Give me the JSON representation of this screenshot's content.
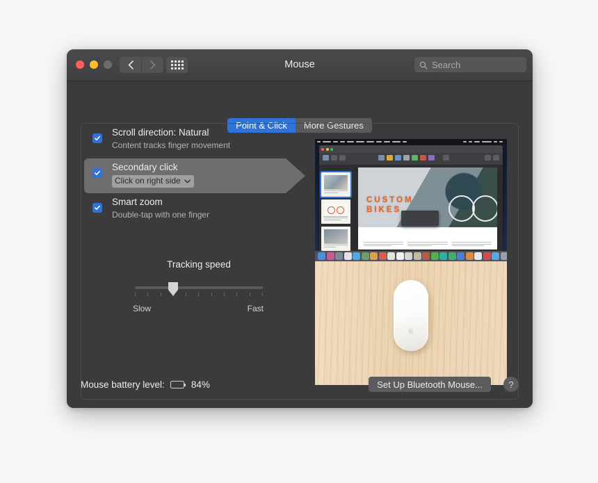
{
  "window": {
    "title": "Mouse",
    "traffic_lights": [
      "close",
      "minimize",
      "zoom-disabled"
    ],
    "nav": {
      "back_icon": "chevron-left-icon",
      "forward_icon": "chevron-right-icon"
    },
    "grid_button_icon": "grid-dots-icon",
    "search": {
      "placeholder": "Search",
      "value": "",
      "icon": "search-icon"
    }
  },
  "tabs": [
    {
      "label": "Point & Click",
      "active": true
    },
    {
      "label": "More Gestures",
      "active": false
    }
  ],
  "options": [
    {
      "title": "Scroll direction: Natural",
      "subtitle": "Content tracks finger movement",
      "checked": true,
      "highlighted": false
    },
    {
      "title": "Secondary click",
      "subtitle": "",
      "checked": true,
      "highlighted": true,
      "popup": {
        "value": "Click on right side",
        "chevron_icon": "chevron-down-icon"
      }
    },
    {
      "title": "Smart zoom",
      "subtitle": "Double-tap with one finger",
      "checked": true,
      "highlighted": false
    }
  ],
  "tracking": {
    "label": "Tracking speed",
    "slow_label": "Slow",
    "fast_label": "Fast",
    "tick_count": 11,
    "value_index": 3,
    "value_percent": 30
  },
  "preview": {
    "top_caption": "macOS Pages document with secondary-click context menu",
    "document_headline_line1": "CUSTOM",
    "document_headline_line2": "BIKES",
    "bottom_caption": "Apple Magic Mouse on wood desk"
  },
  "bottom": {
    "battery_label": "Mouse battery level:",
    "battery_percent": "84%",
    "battery_level": 84,
    "setup_button": "Set Up Bluetooth Mouse...",
    "help_button": "?"
  },
  "colors": {
    "accent_blue": "#2f72d8",
    "window_bg": "#3b3b3d",
    "titlebar_bg": "#454547",
    "page_bg": "#f7f7f7",
    "text_primary": "#ececee",
    "text_secondary": "#b3b3b6",
    "highlight_band": "#6e6e71",
    "orange_headline": "#f0621f"
  }
}
